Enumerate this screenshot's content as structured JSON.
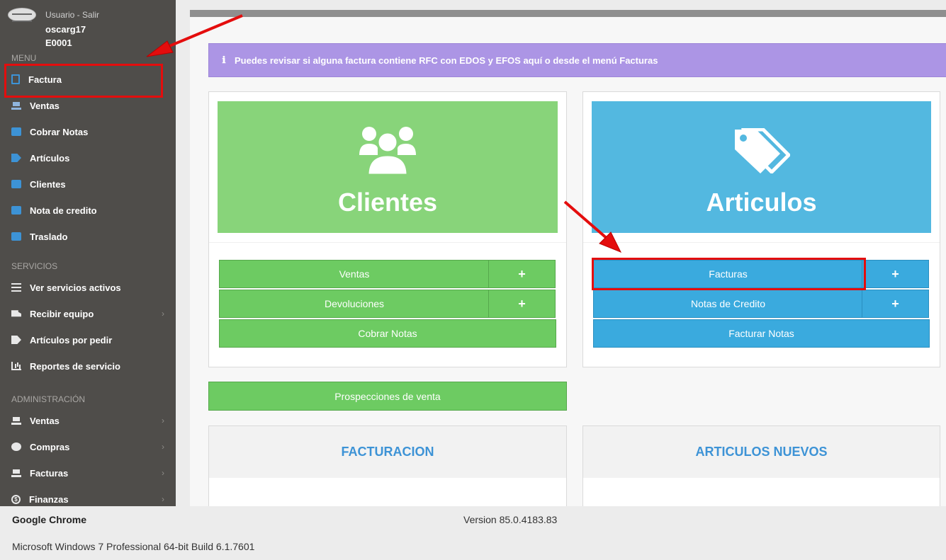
{
  "sidebar": {
    "user_top": "Usuario - Salir",
    "username": "oscarg17",
    "user_code": "E0001",
    "sections": {
      "menu": "MENU",
      "servicios": "SERVICIOS",
      "administracion": "ADMINISTRACIÓN"
    },
    "menu_items": [
      {
        "label": "Factura",
        "icon": "invoice-file-icon"
      },
      {
        "label": "Ventas",
        "icon": "cart-icon"
      },
      {
        "label": "Cobrar Notas",
        "icon": "money-icon"
      },
      {
        "label": "Artículos",
        "icon": "tags-icon"
      },
      {
        "label": "Clientes",
        "icon": "address-book-icon"
      },
      {
        "label": "Nota de credito",
        "icon": "file-icon"
      },
      {
        "label": "Traslado",
        "icon": "file-icon"
      }
    ],
    "servicios_items": [
      {
        "label": "Ver servicios activos",
        "icon": "list-icon"
      },
      {
        "label": "Recibir equipo",
        "icon": "truck-icon",
        "chevron": "›"
      },
      {
        "label": "Artículos por pedir",
        "icon": "tags-icon"
      },
      {
        "label": "Reportes de servicio",
        "icon": "bar-chart-icon"
      }
    ],
    "admin_items": [
      {
        "label": "Ventas",
        "icon": "cart-icon",
        "chevron": "›"
      },
      {
        "label": "Compras",
        "icon": "gear-icon",
        "chevron": "›"
      },
      {
        "label": "Facturas",
        "icon": "cart-icon",
        "chevron": "›"
      },
      {
        "label": "Finanzas",
        "icon": "dollar-icon",
        "chevron": "›"
      }
    ]
  },
  "main": {
    "info_icon": "ℹ",
    "info_text": "Puedes revisar si alguna factura contiene RFC con EDOS y EFOS aquí o desde el menú Facturas",
    "clientes": {
      "title": "Clientes",
      "icon": "users-icon",
      "buttons": {
        "ventas": "Ventas",
        "devoluciones": "Devoluciones",
        "cobrar_notas": "Cobrar Notas"
      },
      "plus": "+"
    },
    "articulos": {
      "title": "Articulos",
      "icon": "tags-icon",
      "buttons": {
        "facturas": "Facturas",
        "notas_credito": "Notas de Credito",
        "facturar_notas": "Facturar Notas"
      },
      "plus": "+"
    },
    "prospecciones": "Prospecciones de venta",
    "facturacion": "FACTURACION",
    "articulos_nuevos": "ARTICULOS NUEVOS"
  },
  "footer": {
    "browser": "Google Chrome",
    "version": "Version 85.0.4183.83",
    "os": "Microsoft Windows 7 Professional  64-bit Build 6.1.7601"
  },
  "colors": {
    "sidebar_bg": "#4f4d4a",
    "green_card": "#88d47a",
    "blue_card": "#53b8e0",
    "green_button": "#6dcb62",
    "blue_button": "#3aaade",
    "info_bar": "#ac95e5",
    "highlight_red": "#e40d0d",
    "section_title_blue": "#3d93d6"
  }
}
